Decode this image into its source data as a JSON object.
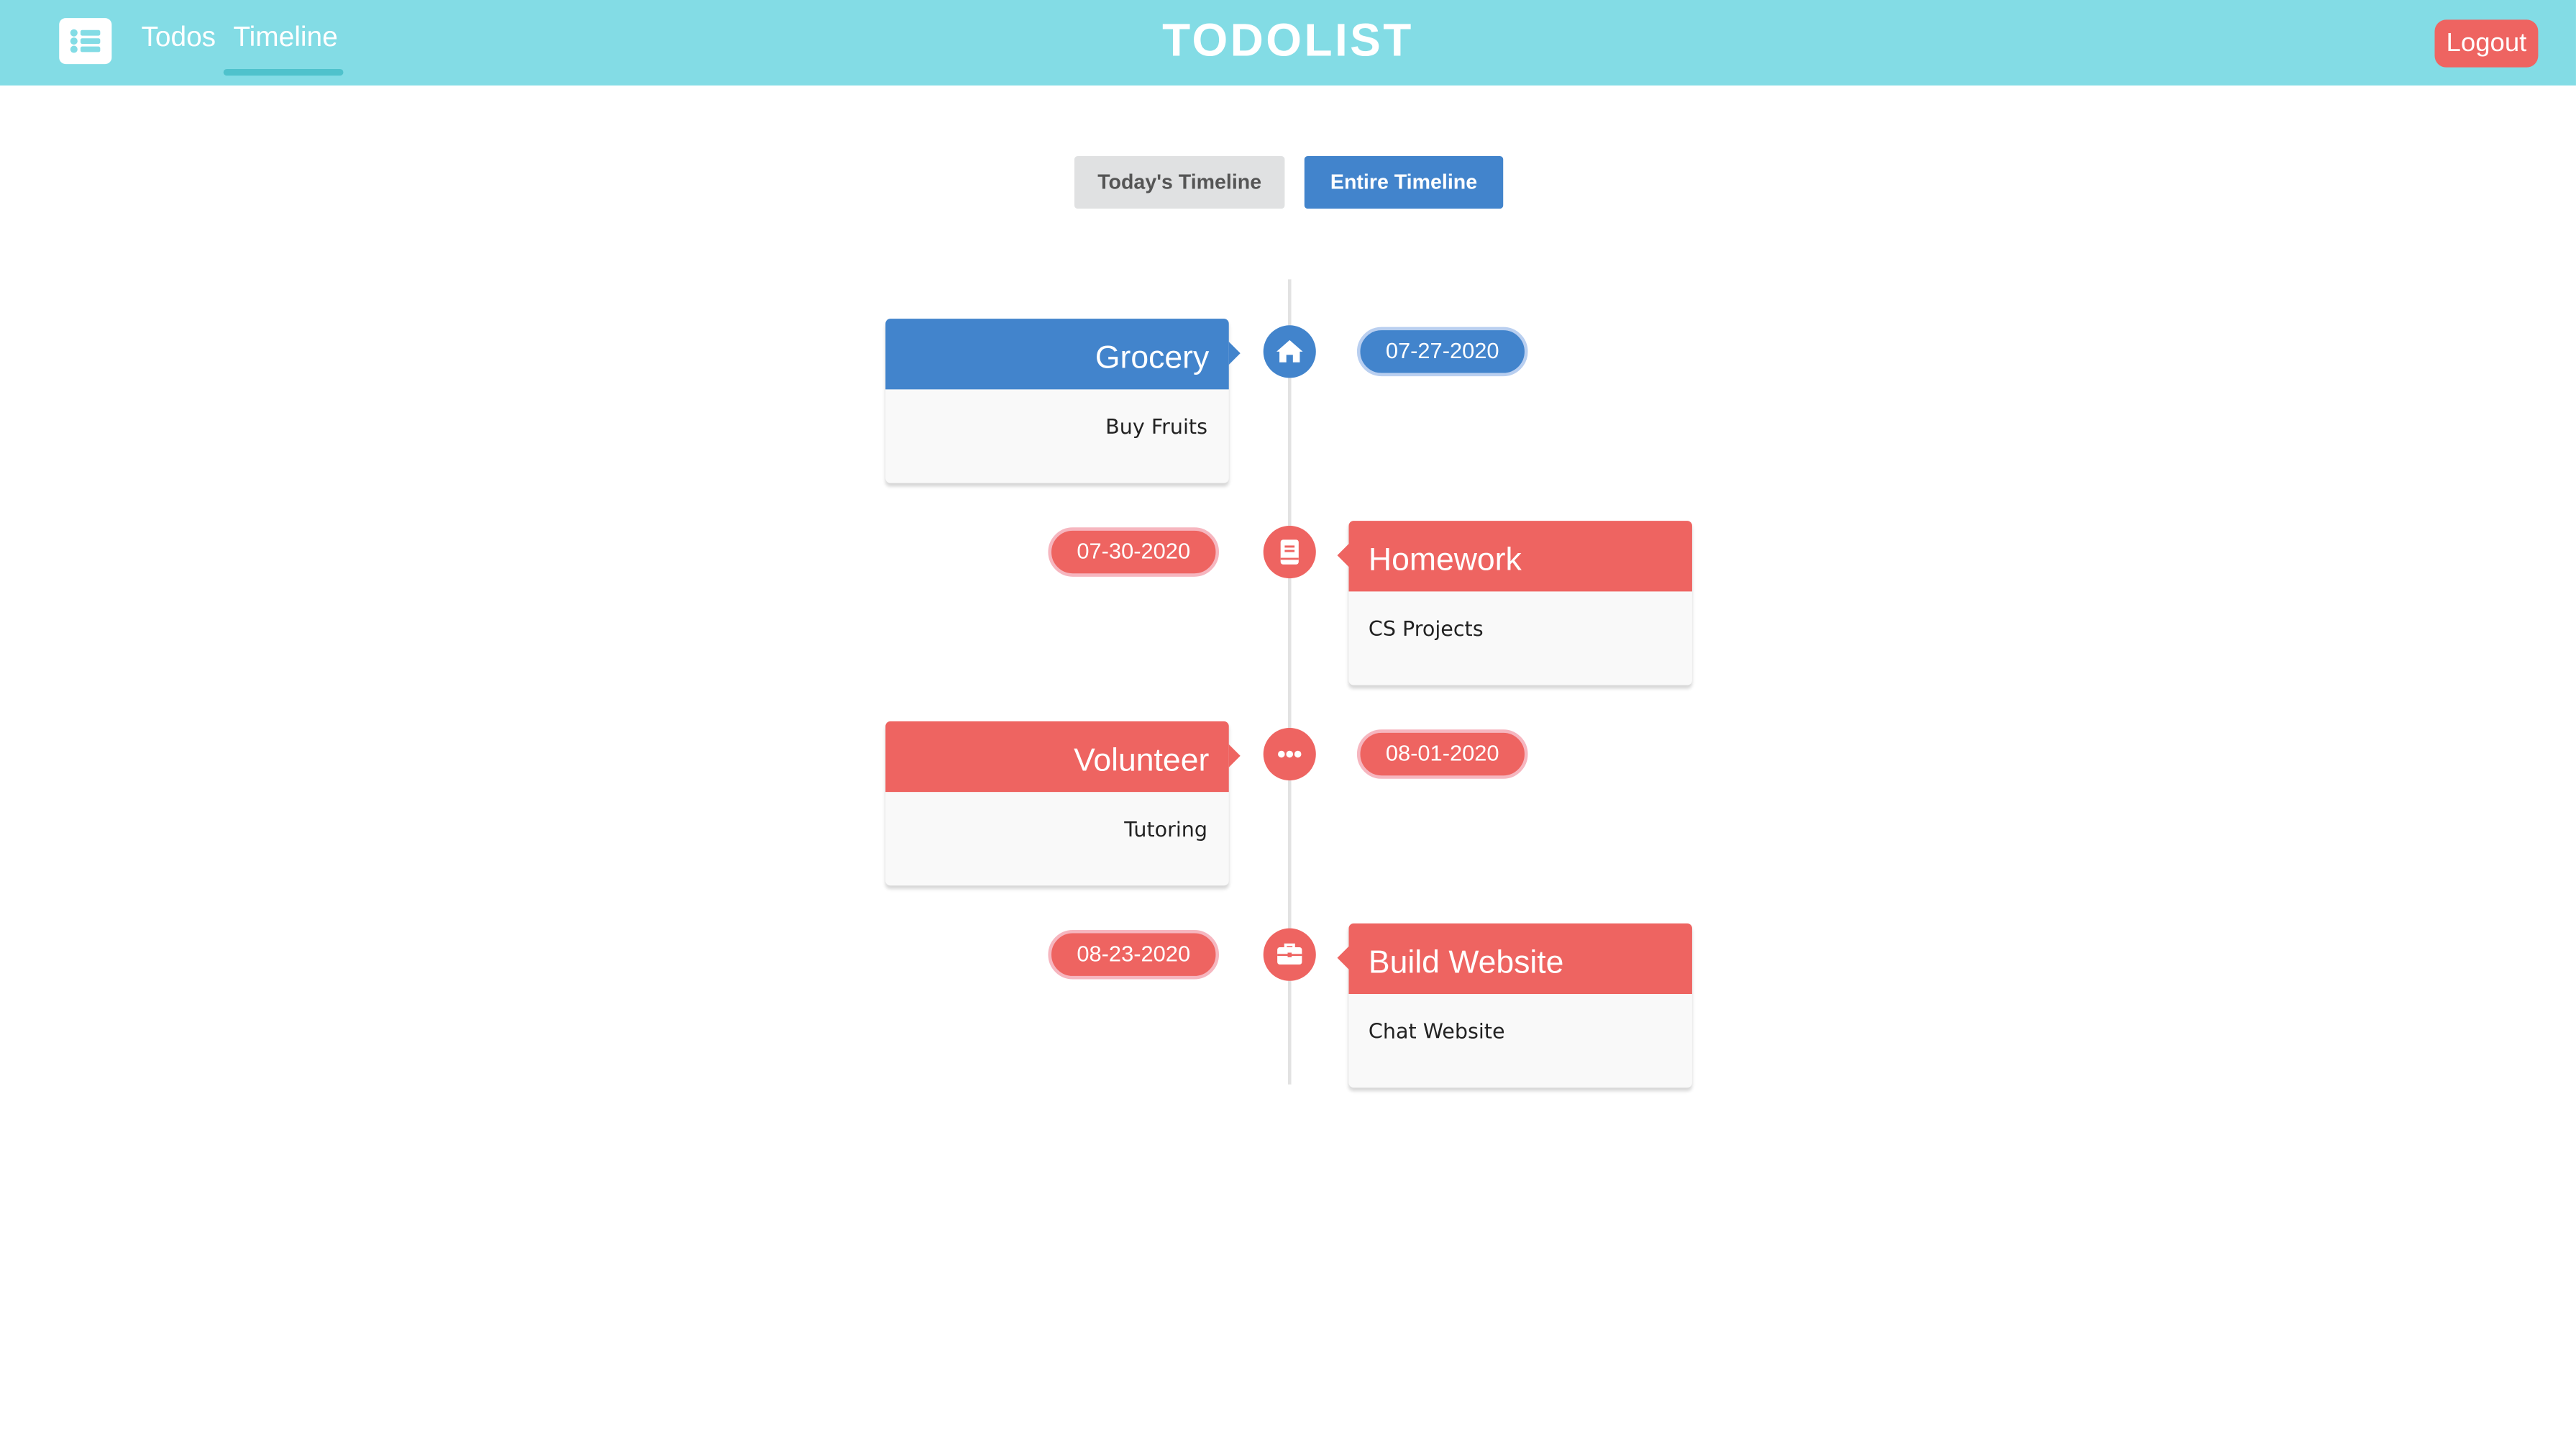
{
  "header": {
    "brand": "TODOLIST",
    "logo_icon": "list-icon",
    "nav": [
      {
        "label": "Todos",
        "active": false
      },
      {
        "label": "Timeline",
        "active": true
      }
    ],
    "logout_label": "Logout"
  },
  "toggle": {
    "today_label": "Today's Timeline",
    "entire_label": "Entire Timeline",
    "active": "entire"
  },
  "colors": {
    "header_bg": "#83dce5",
    "blue": "#4284cc",
    "red": "#ee6461",
    "logout": "#ee6461"
  },
  "timeline": [
    {
      "title": "Grocery",
      "description": "Buy Fruits",
      "date": "07-27-2020",
      "icon": "home-icon",
      "color": "blue",
      "side": "left"
    },
    {
      "title": "Homework",
      "description": "CS Projects",
      "date": "07-30-2020",
      "icon": "book-icon",
      "color": "red",
      "side": "right"
    },
    {
      "title": "Volunteer",
      "description": "Tutoring",
      "date": "08-01-2020",
      "icon": "ellipsis-icon",
      "color": "red",
      "side": "left"
    },
    {
      "title": "Build Website",
      "description": "Chat Website",
      "date": "08-23-2020",
      "icon": "briefcase-icon",
      "color": "red",
      "side": "right"
    }
  ]
}
